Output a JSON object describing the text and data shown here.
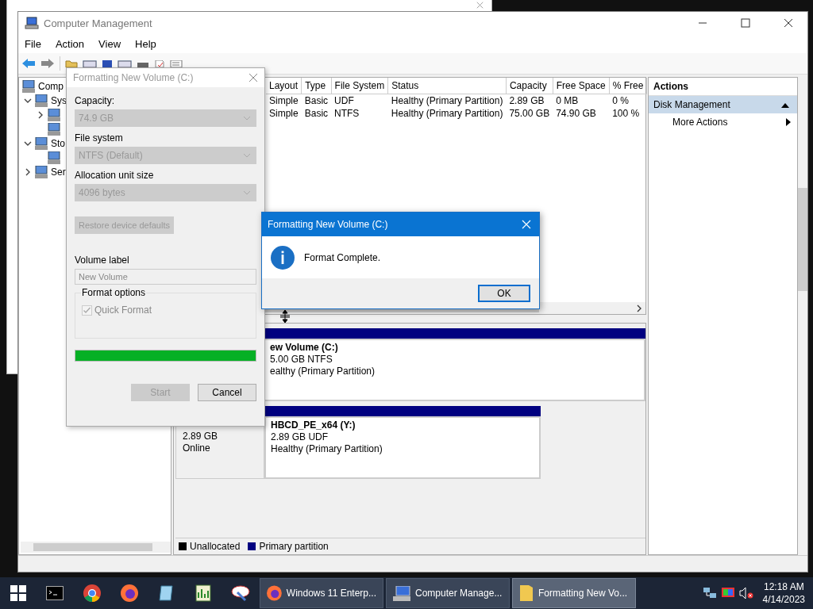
{
  "window": {
    "title": "Computer Management"
  },
  "menu": [
    "File",
    "Action",
    "View",
    "Help"
  ],
  "tree": [
    {
      "label": "Comp",
      "children": [
        {
          "label": "Sys",
          "expandable": true,
          "expanded": true,
          "children": [
            {
              "expandable": true,
              "expanded": false
            },
            {
              "expandable": false
            }
          ]
        },
        {
          "label": "Sto",
          "expandable": true,
          "expanded": true,
          "children": [
            {
              "expandable": false
            }
          ]
        },
        {
          "label": "Ser",
          "expandable": true,
          "expanded": false
        }
      ]
    }
  ],
  "table": {
    "columns": [
      "Layout",
      "Type",
      "File System",
      "Status",
      "Capacity",
      "Free Space",
      "% Free"
    ],
    "rows": [
      [
        "Simple",
        "Basic",
        "UDF",
        "Healthy (Primary Partition)",
        "2.89 GB",
        "0 MB",
        "0 %"
      ],
      [
        "Simple",
        "Basic",
        "NTFS",
        "Healthy (Primary Partition)",
        "75.00 GB",
        "74.90 GB",
        "100 %"
      ]
    ]
  },
  "disks": [
    {
      "partition": {
        "name": "ew Volume  (C:)",
        "size": "5.00 GB NTFS",
        "status": "ealthy (Primary Partition)"
      }
    },
    {
      "info": [
        "2.89 GB",
        "Online"
      ],
      "partition": {
        "name": "HBCD_PE_x64  (Y:)",
        "size": "2.89 GB UDF",
        "status": "Healthy (Primary Partition)"
      }
    }
  ],
  "legend": [
    {
      "label": "Unallocated",
      "color": "#000000"
    },
    {
      "label": "Primary partition",
      "color": "#000080"
    }
  ],
  "actions": {
    "title": "Actions",
    "section": {
      "label": "Disk Management",
      "expanded": true
    },
    "items": [
      "More Actions"
    ]
  },
  "format_dialog": {
    "title": "Formatting New Volume (C:)",
    "fields": [
      {
        "label": "Capacity:",
        "value": "74.9 GB",
        "disabled": true
      },
      {
        "label": "File system",
        "value": "NTFS (Default)",
        "disabled": true
      },
      {
        "label": "Allocation unit size",
        "value": "4096 bytes",
        "disabled": true
      }
    ],
    "restore_button": {
      "label": "Restore device defaults",
      "disabled": true
    },
    "volume_label": {
      "label": "Volume label",
      "value": "New Volume",
      "disabled": true
    },
    "format_options": {
      "title": "Format options",
      "quick_format": {
        "label": "Quick Format",
        "checked": true,
        "disabled": true
      }
    },
    "progress": {
      "level": 1
    },
    "buttons": [
      {
        "label": "Start",
        "disabled": true
      },
      {
        "label": "Cancel",
        "disabled": false
      }
    ]
  },
  "message_box": {
    "title": "Formatting New Volume (C:)",
    "message": "Format Complete.",
    "button": "OK"
  },
  "taskbar": {
    "tasks": [
      {
        "label": "Windows 11 Enterp...",
        "selected": false
      },
      {
        "label": "Computer Manage...",
        "selected": false
      },
      {
        "label": "Formatting New Vo...",
        "selected": true
      }
    ],
    "clock": {
      "time": "12:18 AM",
      "date": "4/14/2023"
    }
  }
}
